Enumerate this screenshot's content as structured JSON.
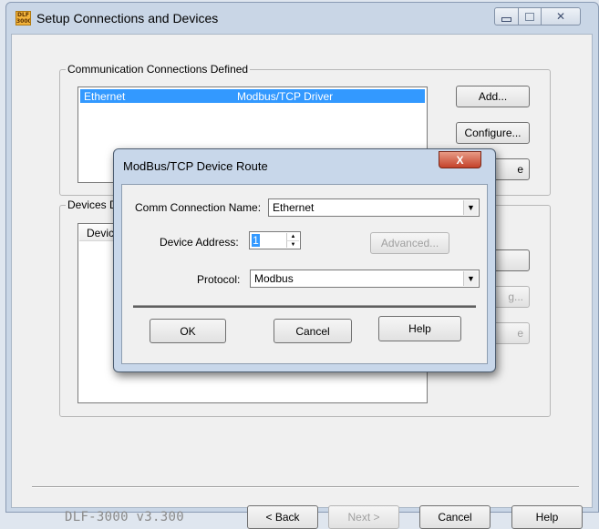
{
  "window": {
    "title": "Setup Connections and Devices",
    "icon_text": "DLF 3000",
    "close_symbol": "✕"
  },
  "connections_group": {
    "legend": "Communication Connections Defined",
    "rows": [
      {
        "name": "Ethernet",
        "driver": "Modbus/TCP Driver",
        "selected": true
      }
    ],
    "buttons": {
      "add": "Add...",
      "configure": "Configure...",
      "remove_partial": "e"
    }
  },
  "devices_group": {
    "legend_partial": "Devices De",
    "column_partial": "Device",
    "buttons": {
      "b2_partial": "g...",
      "b3_partial": "e"
    }
  },
  "footer": {
    "version": "DLF-3000 v3.300",
    "back": "< Back",
    "next": "Next >",
    "cancel": "Cancel",
    "help": "Help"
  },
  "dialog": {
    "title": "ModBus/TCP Device Route",
    "close_symbol": "X",
    "comm_label": "Comm Connection Name:",
    "comm_value": "Ethernet",
    "address_label": "Device Address:",
    "address_value": "1",
    "advanced": "Advanced...",
    "protocol_label": "Protocol:",
    "protocol_value": "Modbus",
    "ok": "OK",
    "cancel": "Cancel",
    "help": "Help"
  },
  "colors": {
    "selection": "#3399ff",
    "dialog_close": "#c4422a",
    "window_frame": "#c9d6e6"
  }
}
